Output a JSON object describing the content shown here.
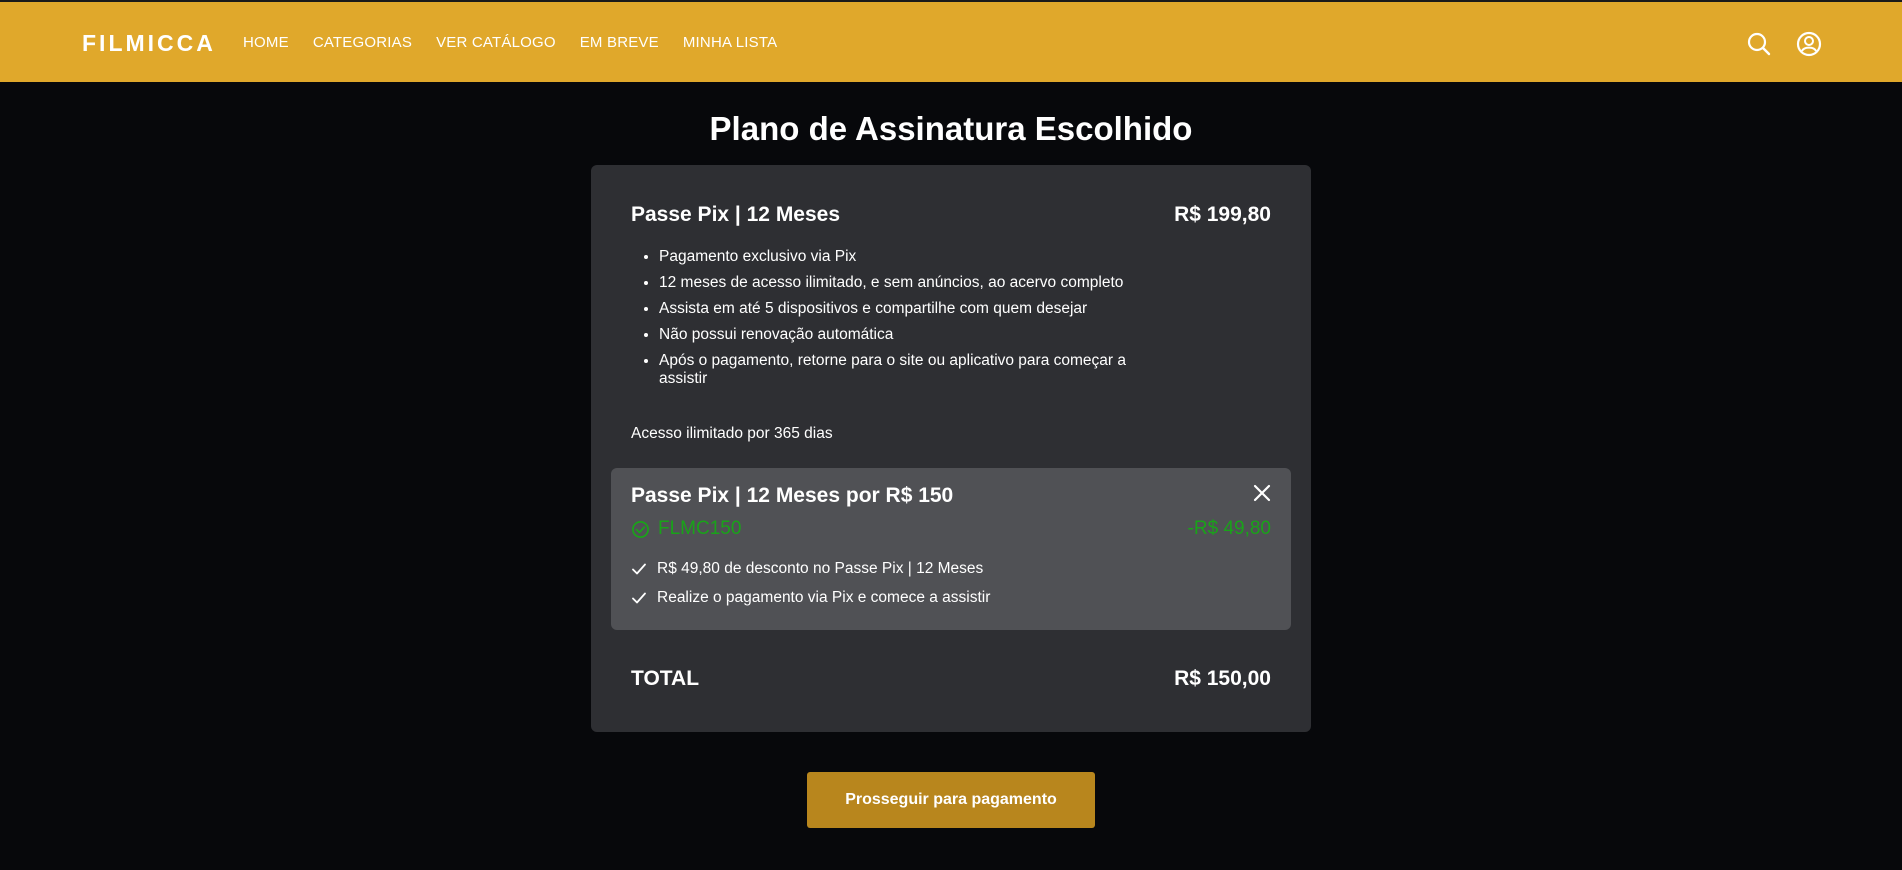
{
  "header": {
    "logo": "FILMICCA",
    "nav": [
      "HOME",
      "CATEGORIAS",
      "VER CATÁLOGO",
      "EM BREVE",
      "MINHA LISTA"
    ],
    "icons": [
      "search-icon",
      "account-icon"
    ],
    "background_color": "#e0a82b"
  },
  "page": {
    "title": "Plano de Assinatura Escolhido"
  },
  "plan": {
    "name": "Passe Pix | 12 Meses",
    "price": "R$ 199,80",
    "features": [
      "Pagamento exclusivo via Pix",
      "12 meses de acesso ilimitado, e sem anúncios, ao acervo completo",
      "Assista em até 5 dispositivos e compartilhe com quem desejar",
      "Não possui renovação automática",
      "Após o pagamento, retorne para o site ou aplicativo para começar a assistir"
    ],
    "access_note": "Acesso ilimitado por 365 dias"
  },
  "coupon": {
    "title": "Passe Pix | 12 Meses por R$ 150",
    "code": "FLMC150",
    "discount": "-R$ 49,80",
    "benefits": [
      "R$ 49,80 de desconto no Passe Pix | 12 Meses",
      "Realize o pagamento via Pix e comece a assistir"
    ],
    "accent_color": "#19a319"
  },
  "total": {
    "label": "TOTAL",
    "value": "R$ 150,00"
  },
  "actions": {
    "proceed_label": "Prosseguir para pagamento",
    "button_color": "#b8861d"
  }
}
